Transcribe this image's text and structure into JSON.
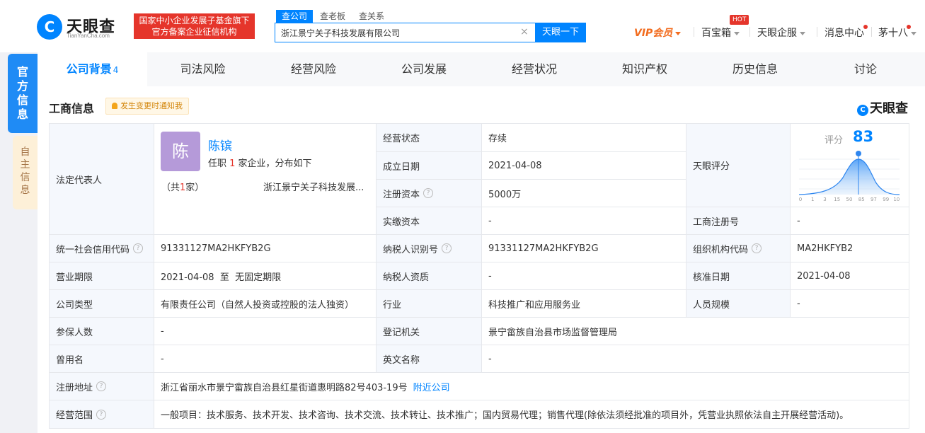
{
  "header": {
    "logo_mark": "C",
    "logo_name": "天眼查",
    "logo_sub": "TianYanCha.com",
    "slogan_line1": "国家中小企业发展子基金旗下",
    "slogan_line2": "官方备案企业征信机构",
    "search_tabs": [
      "查公司",
      "查老板",
      "查关系"
    ],
    "search_value": "浙江景宁关子科技发展有限公司",
    "search_clear": "×",
    "search_button": "天眼一下",
    "nav": {
      "vip": "VIP会员",
      "treasure": "百宝箱",
      "hot": "HOT",
      "enterprise": "天眼企服",
      "messages": "消息中心",
      "user": "茅十八"
    }
  },
  "side": {
    "official": "官方信息",
    "self": "自主信息"
  },
  "tabs": [
    {
      "label": "公司背景",
      "count": "4"
    },
    {
      "label": "司法风险"
    },
    {
      "label": "经营风险"
    },
    {
      "label": "公司发展"
    },
    {
      "label": "经营状况"
    },
    {
      "label": "知识产权"
    },
    {
      "label": "历史信息"
    },
    {
      "label": "讨论"
    }
  ],
  "section": {
    "title": "工商信息",
    "notify": "发生变更时通知我",
    "brand": "天眼查",
    "brand_mark": "C"
  },
  "legal": {
    "label": "法定代表人",
    "avatar": "陈",
    "name": "陈镔",
    "desc_pre": "任职 ",
    "desc_num": "1",
    "desc_post": " 家企业，分布如下",
    "count_pre": "（共",
    "count_num": "1",
    "count_post": "家）",
    "company": "浙江景宁关子科技发展..."
  },
  "score": {
    "label": "天眼评分",
    "text": "评分",
    "value": "83",
    "value_number": 83,
    "ticks": [
      "0",
      "1",
      "3",
      "15",
      "50",
      "85",
      "97",
      "99",
      "100"
    ]
  },
  "fields": {
    "status_label": "经营状态",
    "status": "存续",
    "founded_label": "成立日期",
    "founded": "2021-04-08",
    "reg_capital_label": "注册资本",
    "reg_capital": "5000万",
    "paid_capital_label": "实缴资本",
    "paid_capital": "-",
    "reg_no_label": "工商注册号",
    "reg_no": "-",
    "credit_code_label": "统一社会信用代码",
    "credit_code": "91331127MA2HKFYB2G",
    "taxpayer_id_label": "纳税人识别号",
    "taxpayer_id": "91331127MA2HKFYB2G",
    "org_code_label": "组织机构代码",
    "org_code": "MA2HKFYB2",
    "term_label": "营业期限",
    "term": "2021-04-08  至  无固定期限",
    "taxpayer_quali_label": "纳税人资质",
    "taxpayer_quali": "-",
    "approve_date_label": "核准日期",
    "approve_date": "2021-04-08",
    "type_label": "公司类型",
    "type": "有限责任公司（自然人投资或控股的法人独资）",
    "industry_label": "行业",
    "industry": "科技推广和应用服务业",
    "staff_label": "人员规模",
    "staff": "-",
    "insured_label": "参保人数",
    "insured": "-",
    "authority_label": "登记机关",
    "authority": "景宁畲族自治县市场监督管理局",
    "former_name_label": "曾用名",
    "former_name": "-",
    "english_label": "英文名称",
    "english": "-",
    "address_label": "注册地址",
    "address": "浙江省丽水市景宁畲族自治县红星街道惠明路82号403-19号",
    "nearby": "附近公司",
    "scope_label": "经营范围",
    "scope": "一般项目：技术服务、技术开发、技术咨询、技术交流、技术转让、技术推广；国内贸易代理；销售代理(除依法须经批准的项目外，凭营业执照依法自主开展经营活动)。",
    "help": "?"
  }
}
